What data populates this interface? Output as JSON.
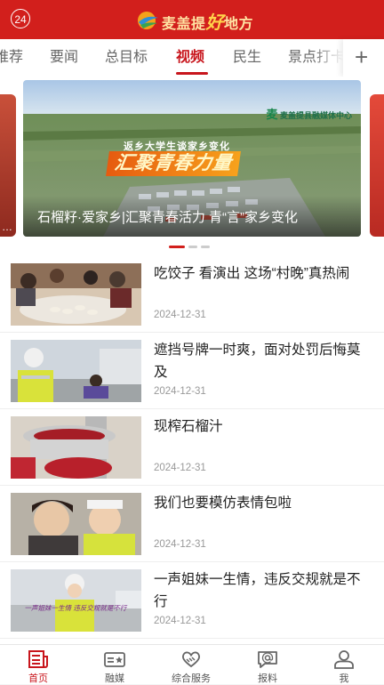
{
  "header": {
    "badge": "24",
    "logo_text_a": "麦盖提",
    "logo_text_hl": "好",
    "logo_text_b": "地方",
    "bg_color": "#d21f1c"
  },
  "tabs": [
    {
      "label": "推荐",
      "active": false
    },
    {
      "label": "要闻",
      "active": false
    },
    {
      "label": "总目标",
      "active": false
    },
    {
      "label": "视频",
      "active": true
    },
    {
      "label": "民生",
      "active": false
    },
    {
      "label": "景点打卡",
      "active": false
    }
  ],
  "tab_add_icon": "+",
  "banner": {
    "left_peek_text": "…",
    "brand_mark": "麦",
    "brand_text": "麦盖提县融媒体中心",
    "overlay_sub": "返乡大学生谈家乡变化",
    "overlay_main": "汇聚青春力量",
    "caption": "石榴籽·爱家乡|汇聚青春活力 青“言”家乡变化",
    "slide_count": 3,
    "active_slide": 0
  },
  "news": [
    {
      "title": "吃饺子 看演出 这场“村晚”真热闹",
      "date": "2024-12-31",
      "thumb": "dumplings-photo"
    },
    {
      "title": "遮挡号牌一时爽，面对处罚后悔莫及",
      "date": "2024-12-31",
      "thumb": "traffic-police-photo"
    },
    {
      "title": "现榨石榴汁",
      "date": "2024-12-31",
      "thumb": "pomegranate-juicer-photo"
    },
    {
      "title": "我们也要模仿表情包啦",
      "date": "2024-12-31",
      "thumb": "meme-faces-photo"
    },
    {
      "title": "一声姐妹一生情，违反交规就是不行",
      "date": "2024-12-31",
      "thumb": "police-officer-photo",
      "thumb_text": "一声姐妹一生情 违反交规就是不行"
    }
  ],
  "bottom_nav": [
    {
      "label": "首页",
      "icon": "newspaper-icon",
      "active": true
    },
    {
      "label": "融媒",
      "icon": "media-card-icon",
      "active": false
    },
    {
      "label": "综合服务",
      "icon": "handshake-heart-icon",
      "active": false
    },
    {
      "label": "报料",
      "icon": "chat-at-icon",
      "active": false
    },
    {
      "label": "我",
      "icon": "user-icon",
      "active": false
    }
  ],
  "colors": {
    "accent": "#c8161d",
    "muted": "#999999"
  }
}
